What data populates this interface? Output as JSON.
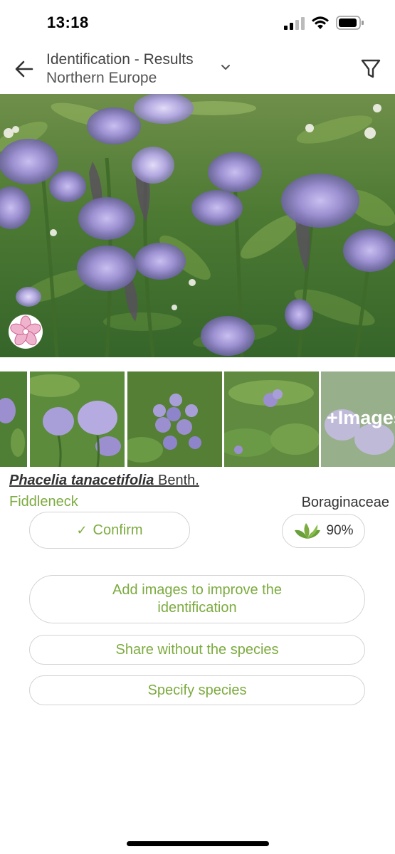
{
  "status_bar": {
    "time": "13:18"
  },
  "header": {
    "title": "Identification - Results",
    "subtitle": "Northern Europe"
  },
  "thumbnails": {
    "more_label": "+Images"
  },
  "result": {
    "scientific_name": "Phacelia tanacetifolia",
    "author": "Benth.",
    "common_name": "Fiddleneck",
    "family": "Boraginaceae",
    "score": "90%",
    "confirm_label": "Confirm"
  },
  "actions": {
    "add_images": "Add images to improve the identification",
    "share_without": "Share without the species",
    "specify": "Specify species"
  },
  "icons": [
    "back-arrow-icon",
    "chevron-down-icon",
    "filter-icon",
    "flower-icon",
    "check-icon",
    "leaf-icon",
    "signal-icon",
    "wifi-icon",
    "battery-icon"
  ],
  "colors": {
    "accent_green": "#7cab3f",
    "border": "#d3d3d3",
    "flower_purple": "#9b8fd0",
    "badge_pink": "#e38fb4"
  }
}
